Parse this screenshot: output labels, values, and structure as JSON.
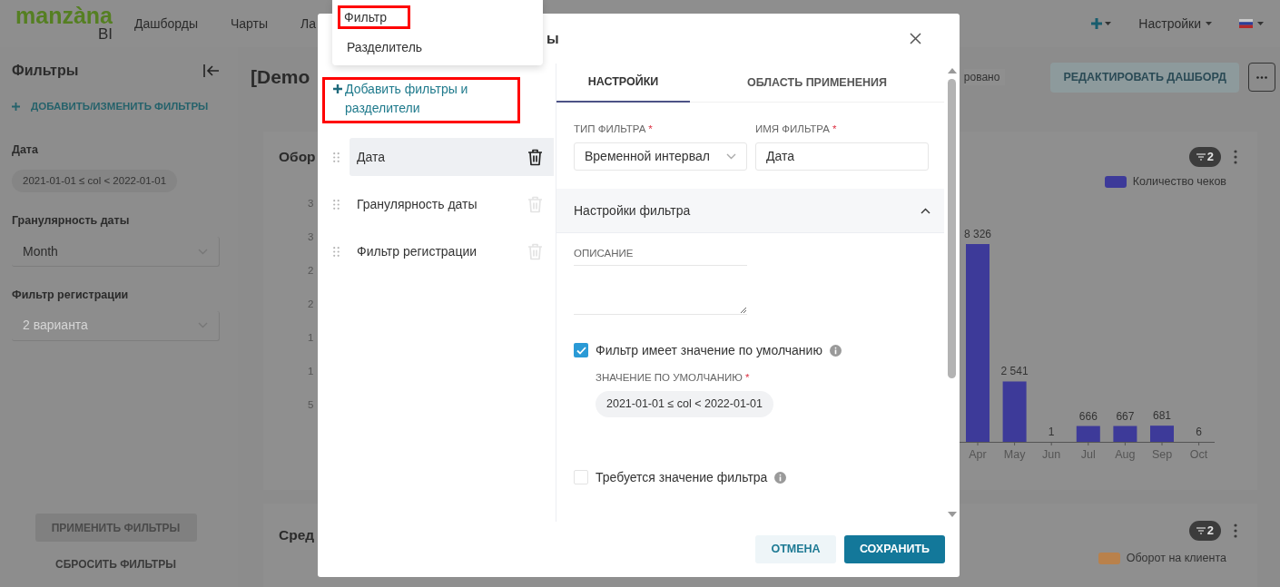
{
  "nav": {
    "logo": "manzàna",
    "logo_sub": "BI",
    "items": [
      "Дашборды",
      "Чарты",
      "Ла"
    ],
    "settings": "Настройки"
  },
  "sidebar": {
    "title": "Фильтры",
    "add_link": "ДОБАВИТЬ/ИЗМЕНИТЬ ФИЛЬТРЫ",
    "filters": [
      {
        "kind": "chip",
        "label": "Дата",
        "value": "2021-01-01 ≤ col < 2022-01-01"
      },
      {
        "kind": "select",
        "label": "Гранулярность даты",
        "value": "Month"
      },
      {
        "kind": "select",
        "label": "Фильтр регистрации",
        "placeholder": "2 варианта"
      }
    ],
    "apply": "ПРИМЕНИТЬ ФИЛЬТРЫ",
    "reset": "СБРОСИТЬ ФИЛЬТРЫ"
  },
  "dashboard": {
    "title": "[Demo",
    "status": "ровано",
    "edit_button": "РЕДАКТИРОВАТЬ ДАШБОРД"
  },
  "charts": [
    {
      "title": "Обор",
      "filter_count": "2",
      "axis_fragments": [
        "3",
        "3",
        "2",
        "2",
        "1",
        "1",
        "5"
      ],
      "chart_data": {
        "type": "bar",
        "categories": [
          "Apr",
          "May",
          "Jun",
          "Jul",
          "Aug",
          "Sep",
          "Oct"
        ],
        "series": [
          {
            "name": "Количество чеков",
            "color": "#3d3a99",
            "values": [
              8326,
              2541,
              1,
              666,
              667,
              681,
              6
            ]
          }
        ],
        "data_labels": true,
        "value_labels": [
          "8 326",
          "2 541",
          "1",
          "666",
          "667",
          "681",
          "6"
        ]
      }
    },
    {
      "title": "Сред",
      "filter_count": "2",
      "legend": {
        "name": "Оборот на клиента",
        "color": "#b9814b"
      }
    }
  ],
  "modal": {
    "title": "ы",
    "menu": [
      {
        "label": "Фильтр",
        "highlighted": true
      },
      {
        "label": "Разделитель",
        "highlighted": false
      }
    ],
    "add_link": {
      "label": "Добавить фильтры и разделители",
      "highlighted": true
    },
    "filters": [
      {
        "name": "Дата",
        "selected": true
      },
      {
        "name": "Гранулярность даты",
        "selected": false
      },
      {
        "name": "Фильтр регистрации",
        "selected": false
      }
    ],
    "tabs": [
      {
        "label": "НАСТРОЙКИ",
        "selected": true
      },
      {
        "label": "ОБЛАСТЬ ПРИМЕНЕНИЯ",
        "selected": false
      }
    ],
    "fields": [
      {
        "kind": "select",
        "label": "ТИП ФИЛЬТРА",
        "mark": "*",
        "value": "Временной интервал"
      },
      {
        "kind": "text",
        "label": "ИМЯ ФИЛЬТРА",
        "mark": "*",
        "value": "Дата"
      }
    ],
    "section": {
      "title": "Настройки фильтра",
      "expanded": true
    },
    "description_label": "ОПИСАНИЕ",
    "options": [
      {
        "label": "Фильтр имеет значение по умолчанию",
        "checked": true,
        "sub_label": "ЗНАЧЕНИЕ ПО УМОЛЧАНИЮ",
        "sub_mark": "*",
        "sub_value": "2021-01-01 ≤ col < 2022-01-01"
      },
      {
        "label": "Требуется значение фильтра",
        "checked": false
      }
    ],
    "cancel": "ОТМЕНА",
    "save": "СОХРАНИТЬ"
  }
}
